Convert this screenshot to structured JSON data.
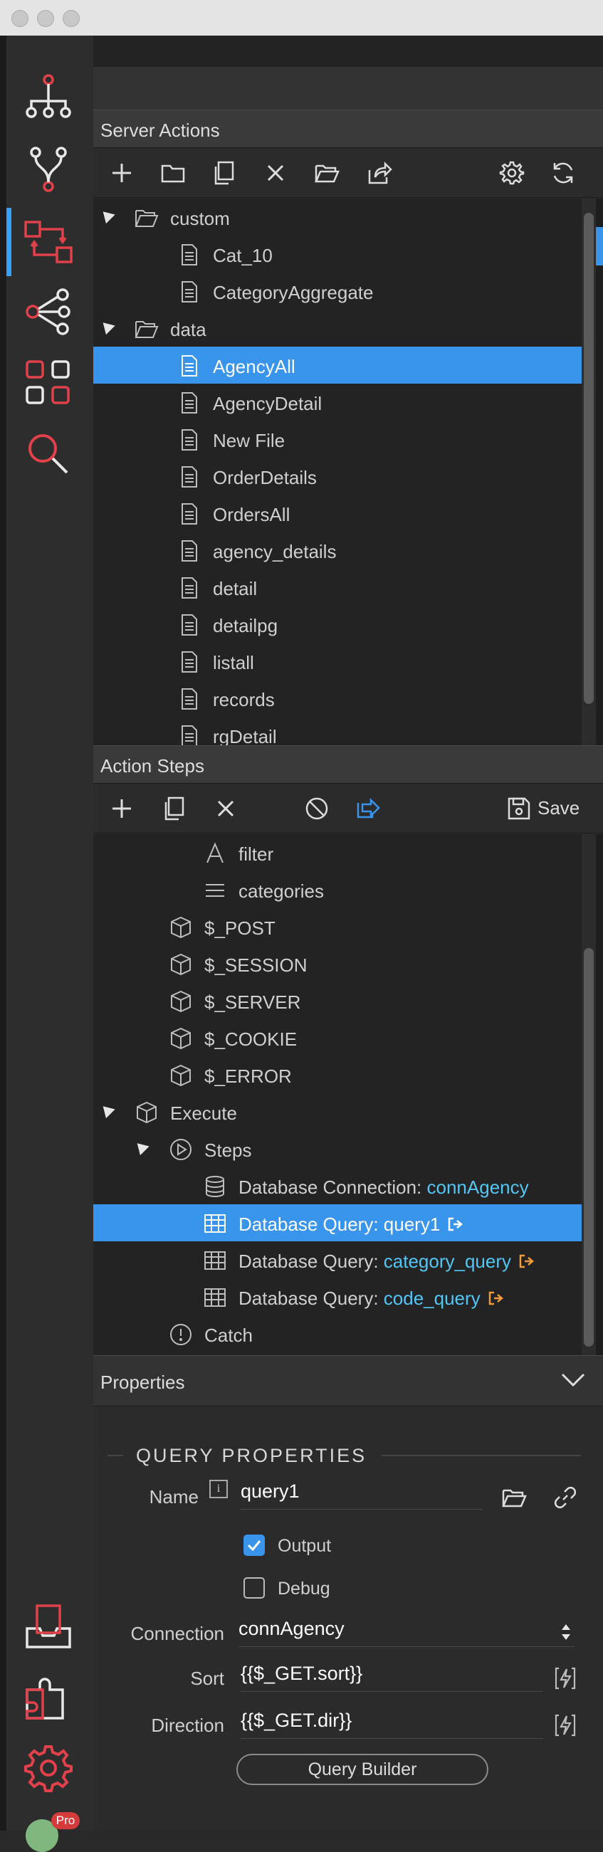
{
  "colors": {
    "accent": "#3994ec",
    "sidebar_icon_red": "#e0414a",
    "link_value": "#52c6f5",
    "output_icon": "#f29a3d"
  },
  "sidebar": {
    "items": [
      {
        "icon": "site-structure-icon"
      },
      {
        "icon": "git-branch-icon"
      },
      {
        "icon": "server-connect-icon",
        "active": true
      },
      {
        "icon": "share-icon"
      },
      {
        "icon": "apps-grid-icon"
      },
      {
        "icon": "search-icon"
      }
    ],
    "bottom": [
      {
        "icon": "inbox-icon"
      },
      {
        "icon": "extensions-icon"
      },
      {
        "icon": "settings-gear-icon"
      }
    ],
    "pro_badge": "Pro"
  },
  "server_actions": {
    "title": "Server Actions",
    "tree": [
      {
        "label": "custom",
        "type": "folder",
        "level": 0,
        "expanded": true
      },
      {
        "label": "Cat_10",
        "type": "file",
        "level": 1
      },
      {
        "label": "CategoryAggregate",
        "type": "file",
        "level": 1
      },
      {
        "label": "data",
        "type": "folder",
        "level": 0,
        "expanded": true
      },
      {
        "label": "AgencyAll",
        "type": "file",
        "level": 1,
        "selected": true
      },
      {
        "label": "AgencyDetail",
        "type": "file",
        "level": 1
      },
      {
        "label": "New File",
        "type": "file",
        "level": 1
      },
      {
        "label": "OrderDetails",
        "type": "file",
        "level": 1
      },
      {
        "label": "OrdersAll",
        "type": "file",
        "level": 1
      },
      {
        "label": "agency_details",
        "type": "file",
        "level": 1
      },
      {
        "label": "detail",
        "type": "file",
        "level": 1
      },
      {
        "label": "detailpg",
        "type": "file",
        "level": 1
      },
      {
        "label": "listall",
        "type": "file",
        "level": 1
      },
      {
        "label": "records",
        "type": "file",
        "level": 1
      },
      {
        "label": "rgDetail",
        "type": "file",
        "level": 1
      }
    ]
  },
  "action_steps": {
    "title": "Action Steps",
    "save_label": "Save",
    "tree": [
      {
        "label": "filter",
        "icon": "text-icon",
        "level": 3
      },
      {
        "label": "categories",
        "icon": "list-icon",
        "level": 3
      },
      {
        "label": "$_POST",
        "icon": "cube-icon",
        "level": 2
      },
      {
        "label": "$_SESSION",
        "icon": "cube-icon",
        "level": 2
      },
      {
        "label": "$_SERVER",
        "icon": "cube-icon",
        "level": 2
      },
      {
        "label": "$_COOKIE",
        "icon": "cube-icon",
        "level": 2
      },
      {
        "label": "$_ERROR",
        "icon": "cube-icon",
        "level": 2
      },
      {
        "label": "Execute",
        "icon": "cube-icon",
        "level": 1,
        "expanded": true
      },
      {
        "label": "Steps",
        "icon": "play-icon",
        "level": 2,
        "expanded": true
      },
      {
        "label": "Database Connection: ",
        "value": "connAgency",
        "icon": "database-icon",
        "level": 3
      },
      {
        "label": "Database Query: ",
        "value": "query1",
        "icon": "table-icon",
        "level": 3,
        "selected": true,
        "output": true
      },
      {
        "label": "Database Query: ",
        "value": "category_query",
        "icon": "table-icon",
        "level": 3,
        "output": true
      },
      {
        "label": "Database Query: ",
        "value": "code_query",
        "icon": "table-icon",
        "level": 3,
        "output": true
      },
      {
        "label": "Catch",
        "icon": "alert-icon",
        "level": 2
      }
    ]
  },
  "properties": {
    "title": "Properties",
    "section": "QUERY PROPERTIES",
    "name_label": "Name",
    "name_value": "query1",
    "output_label": "Output",
    "output_checked": true,
    "debug_label": "Debug",
    "debug_checked": false,
    "connection_label": "Connection",
    "connection_value": "connAgency",
    "sort_label": "Sort",
    "sort_value": "{{$_GET.sort}}",
    "direction_label": "Direction",
    "direction_value": "{{$_GET.dir}}",
    "query_builder_label": "Query Builder"
  }
}
